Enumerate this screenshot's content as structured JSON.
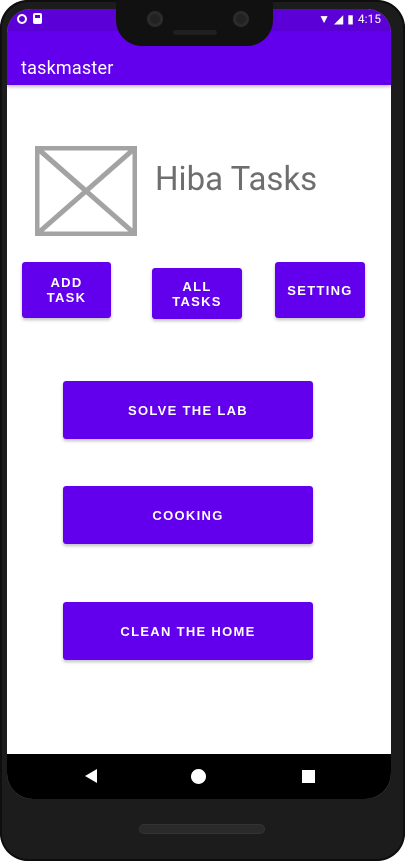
{
  "status": {
    "time": "4:15"
  },
  "appbar": {
    "title": "taskmaster"
  },
  "header": {
    "image": "image-placeholder-icon",
    "title": "Hiba Tasks"
  },
  "top_buttons": [
    "ADD TASK",
    "ALL TASKS",
    "SETTING"
  ],
  "tasks": [
    "SOLVE THE LAB",
    "COOKING",
    "CLEAN THE HOME"
  ],
  "colors": {
    "primary": "#6200EE",
    "status": "#5B00D6"
  }
}
